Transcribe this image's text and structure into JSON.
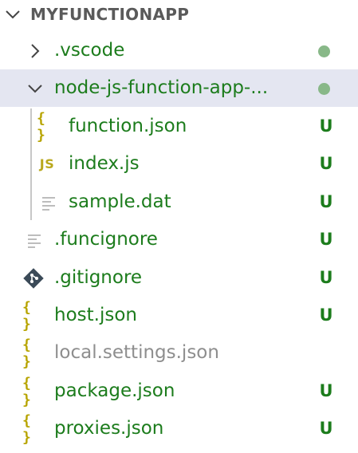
{
  "explorer": {
    "section_title": "MYFUNCTIONAPP",
    "items": [
      {
        "label": ".vscode",
        "type": "folder",
        "expanded": false,
        "status": "dot",
        "status_text": ""
      },
      {
        "label": "node-js-function-app-...",
        "type": "folder",
        "expanded": true,
        "selected": true,
        "status": "dot",
        "status_text": ""
      },
      {
        "label": "function.json",
        "type": "json",
        "status": "untracked",
        "status_text": "U"
      },
      {
        "label": "index.js",
        "type": "js",
        "icon_text": "JS",
        "status": "untracked",
        "status_text": "U"
      },
      {
        "label": "sample.dat",
        "type": "text",
        "status": "untracked",
        "status_text": "U"
      },
      {
        "label": ".funcignore",
        "type": "text",
        "status": "untracked",
        "status_text": "U"
      },
      {
        "label": ".gitignore",
        "type": "git",
        "status": "untracked",
        "status_text": "U"
      },
      {
        "label": "host.json",
        "type": "json",
        "status": "untracked",
        "status_text": "U"
      },
      {
        "label": "local.settings.json",
        "type": "json",
        "status": "ignored",
        "status_text": ""
      },
      {
        "label": "package.json",
        "type": "json",
        "status": "untracked",
        "status_text": "U"
      },
      {
        "label": "proxies.json",
        "type": "json",
        "status": "untracked",
        "status_text": "U"
      }
    ],
    "icon_glyphs": {
      "json": "{ }"
    }
  },
  "colors": {
    "untracked_text": "#1c7c1c",
    "ignored_text": "#8e8e8e",
    "modified_dot": "#88b888",
    "selection_bg": "#e4e6f1",
    "json_icon": "#b7a400",
    "js_icon": "#b9a81d",
    "header_text": "#5a5a5a"
  },
  "icons": {
    "section_chevron": "chevron-down-icon",
    "collapsed_folder": "chevron-right-icon",
    "expanded_folder": "chevron-down-icon",
    "json_file": "json-braces-icon",
    "js_file": "javascript-icon",
    "text_file": "text-lines-icon",
    "git_file": "git-icon"
  }
}
